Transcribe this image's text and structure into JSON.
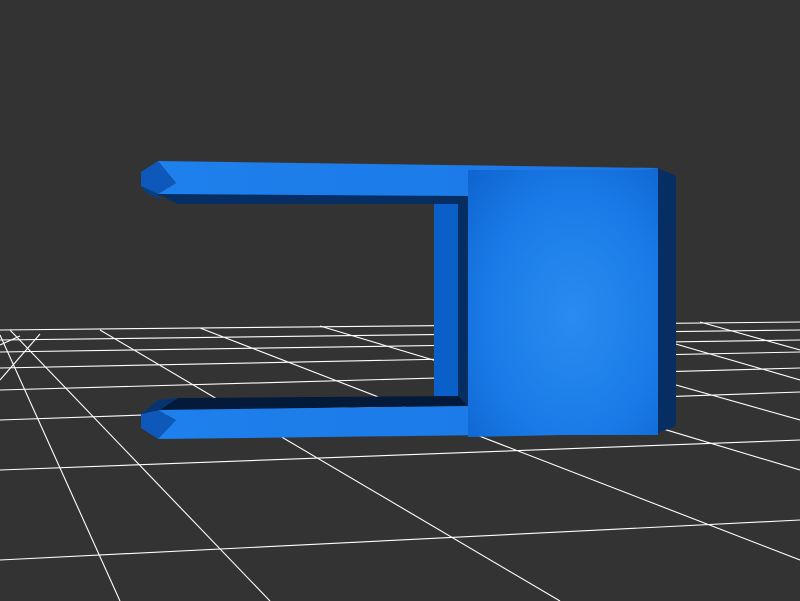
{
  "viewport": {
    "background_color": "#333333",
    "grid_color": "#ffffff"
  },
  "model": {
    "shape": "u-shaped-bracket",
    "colors": {
      "face_light": "#2a8cf0",
      "face_mid": "#1976e6",
      "face_dark": "#0a5fc4",
      "side": "#0d58b8",
      "shadow": "#062e63",
      "deep_shadow": "#031a3a"
    }
  }
}
